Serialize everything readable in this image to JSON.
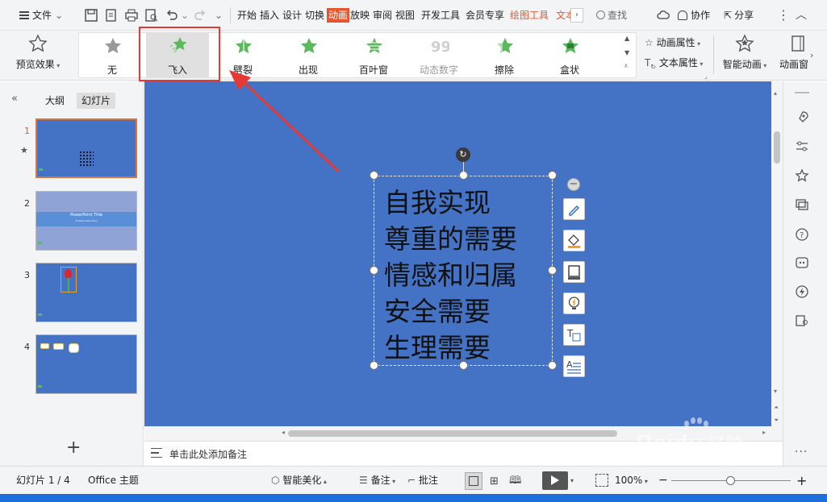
{
  "menubar": {
    "file_label": "文件",
    "tabs": [
      {
        "label": "开始",
        "state": "normal"
      },
      {
        "label": "插入",
        "state": "normal"
      },
      {
        "label": "设计",
        "state": "normal"
      },
      {
        "label": "切换",
        "state": "normal"
      },
      {
        "label": "动画",
        "state": "active"
      },
      {
        "label": "放映",
        "state": "normal"
      },
      {
        "label": "审阅",
        "state": "normal"
      },
      {
        "label": "视图",
        "state": "normal"
      },
      {
        "label": "开发工具",
        "state": "normal"
      },
      {
        "label": "会员专享",
        "state": "normal"
      },
      {
        "label": "绘图工具",
        "state": "contextual"
      },
      {
        "label": "文本",
        "state": "contextual"
      }
    ],
    "search_label": "查找",
    "collab_label": "协作",
    "share_label": "分享"
  },
  "ribbon": {
    "preview_label": "预览效果",
    "effects": [
      {
        "label": "无",
        "state": "normal"
      },
      {
        "label": "飞入",
        "state": "selected"
      },
      {
        "label": "劈裂",
        "state": "normal"
      },
      {
        "label": "出现",
        "state": "normal"
      },
      {
        "label": "百叶窗",
        "state": "normal"
      },
      {
        "label": "动态数字",
        "state": "disabled"
      },
      {
        "label": "擦除",
        "state": "normal"
      },
      {
        "label": "盒状",
        "state": "normal"
      }
    ],
    "anim_props_label": "动画属性",
    "text_props_label": "文本属性",
    "smart_anim_label": "智能动画",
    "anim_pane_label": "动画窗"
  },
  "leftpanel": {
    "outline_tab": "大纲",
    "slides_tab": "幻灯片",
    "slides": [
      {
        "num": "1",
        "selected": true
      },
      {
        "num": "2",
        "selected": false,
        "title": "PowerPoint Title",
        "subtitle": "Subtitle Text Here"
      },
      {
        "num": "3",
        "selected": false
      },
      {
        "num": "4",
        "selected": false
      }
    ],
    "add_label": "+"
  },
  "slide": {
    "lines": [
      "自我实现",
      "尊重的需要",
      "情感和归属",
      "安全需要",
      "生理需要"
    ]
  },
  "notes": {
    "placeholder": "单击此处添加备注"
  },
  "statusbar": {
    "slide_info": "幻灯片 1 / 4",
    "theme": "Office 主题",
    "beautify": "智能美化",
    "notes": "备注",
    "comments": "批注",
    "zoom": "100%"
  },
  "watermark": {
    "brand": "Bai",
    "brand2": "du",
    "brand_cn": "经验",
    "url": "jingyan.baidu.com"
  },
  "colors": {
    "accent": "#e4572e",
    "slide_bg": "#4472c4",
    "annotation": "#e53935",
    "star_green": "#5cb85c"
  }
}
